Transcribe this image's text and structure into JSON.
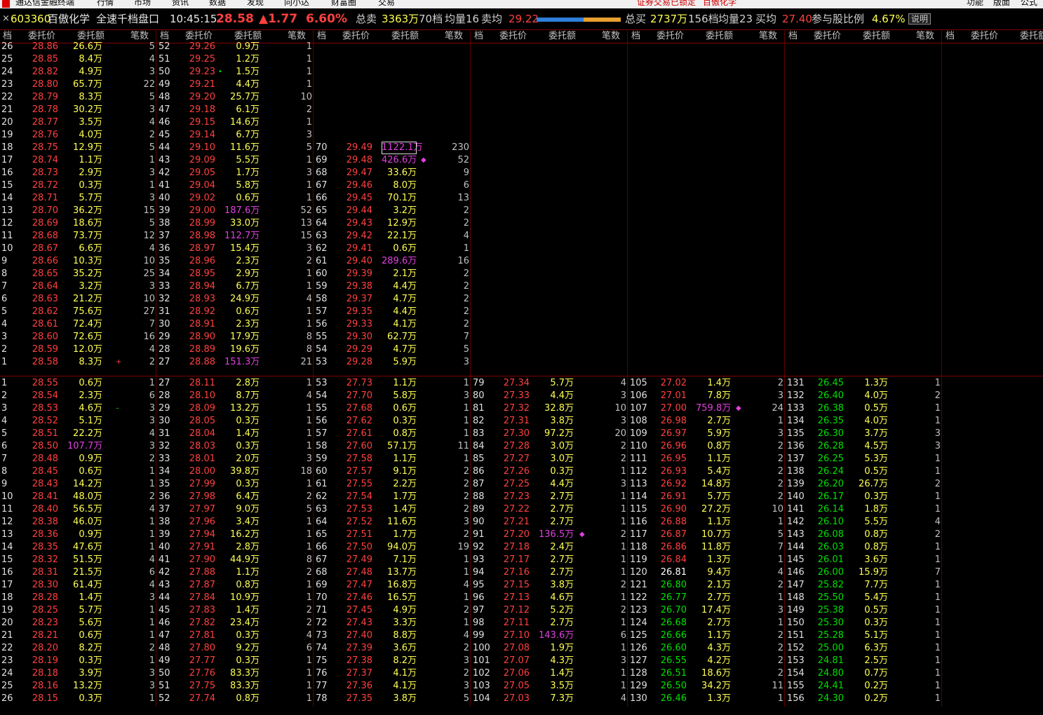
{
  "menubar": {
    "app_title": "通达信金融终端",
    "items": [
      "行情",
      "市场",
      "资讯",
      "数据",
      "发现",
      "向小达",
      "财富圈",
      "交易"
    ],
    "warning": "证券交易已锁定",
    "stock_name": "百傲化学",
    "right_items": [
      "功能",
      "版面",
      "公式"
    ]
  },
  "info": {
    "close": "×",
    "code": "603360",
    "name": "百傲化学",
    "title": "全速千档盘口",
    "time": "10:45:15",
    "price": "28.58",
    "change": "▲1.77",
    "pct": "6.60%",
    "sell_total_label": "总卖",
    "sell_total": "3363万",
    "sell_levels": "70档",
    "sell_avg_label": "均量16",
    "sell_avgp_label": "卖均",
    "sell_avgp": "29.22",
    "buy_total_label": "总买",
    "buy_total": "2737万",
    "buy_levels": "156档",
    "buy_avg_label": "均量23",
    "buy_avgp_label": "买均",
    "buy_avgp": "27.40",
    "part_label": "参与股比例",
    "part_pct": "4.67%",
    "help": "说明",
    "buy_ratio": 0.56
  },
  "header": {
    "lv": "档",
    "price": "委托价",
    "amt": "委托额",
    "cnt": "笔数"
  },
  "colors": {
    "up": "#ff4040",
    "down": "#00e000",
    "amount": "#ffff54",
    "big": "#e040e0",
    "flat": "#ffffff"
  },
  "sell": [
    [
      [
        26,
        "28.86",
        "26.6万",
        5
      ],
      [
        25,
        "28.85",
        "8.4万",
        4
      ],
      [
        24,
        "28.82",
        "4.9万",
        3
      ],
      [
        23,
        "28.80",
        "65.7万",
        22
      ],
      [
        22,
        "28.79",
        "8.3万",
        5
      ],
      [
        21,
        "28.78",
        "30.2万",
        3
      ],
      [
        20,
        "28.77",
        "3.5万",
        4
      ],
      [
        19,
        "28.76",
        "4.0万",
        2
      ],
      [
        18,
        "28.75",
        "12.9万",
        5
      ],
      [
        17,
        "28.74",
        "1.1万",
        1
      ],
      [
        16,
        "28.73",
        "2.9万",
        3
      ],
      [
        15,
        "28.72",
        "0.3万",
        1
      ],
      [
        14,
        "28.71",
        "5.7万",
        3
      ],
      [
        13,
        "28.70",
        "36.2万",
        15
      ],
      [
        12,
        "28.69",
        "18.6万",
        5
      ],
      [
        11,
        "28.68",
        "73.7万",
        12
      ],
      [
        10,
        "28.67",
        "6.6万",
        4
      ],
      [
        9,
        "28.66",
        "10.3万",
        10
      ],
      [
        8,
        "28.65",
        "35.2万",
        25
      ],
      [
        7,
        "28.64",
        "3.2万",
        3
      ],
      [
        6,
        "28.63",
        "21.2万",
        10
      ],
      [
        5,
        "28.62",
        "75.6万",
        27
      ],
      [
        4,
        "28.61",
        "72.4万",
        7
      ],
      [
        3,
        "28.60",
        "72.6万",
        16
      ],
      [
        2,
        "28.59",
        "12.0万",
        4
      ],
      [
        1,
        "28.58",
        "8.3万",
        2
      ]
    ],
    [
      [
        52,
        "29.26",
        "0.9万",
        1
      ],
      [
        51,
        "29.25",
        "1.2万",
        1
      ],
      [
        50,
        "29.23",
        "1.5万",
        1
      ],
      [
        49,
        "29.21",
        "4.4万",
        1
      ],
      [
        48,
        "29.20",
        "25.7万",
        10
      ],
      [
        47,
        "29.18",
        "6.1万",
        2
      ],
      [
        46,
        "29.15",
        "14.6万",
        1
      ],
      [
        45,
        "29.14",
        "6.7万",
        3
      ],
      [
        44,
        "29.10",
        "11.6万",
        5
      ],
      [
        43,
        "29.09",
        "5.5万",
        1
      ],
      [
        42,
        "29.05",
        "1.7万",
        3
      ],
      [
        41,
        "29.04",
        "5.8万",
        1
      ],
      [
        40,
        "29.02",
        "0.6万",
        1
      ],
      [
        39,
        "29.00",
        "187.6万",
        52
      ],
      [
        38,
        "28.99",
        "33.0万",
        13
      ],
      [
        37,
        "28.98",
        "112.7万",
        15
      ],
      [
        36,
        "28.97",
        "15.4万",
        3
      ],
      [
        35,
        "28.96",
        "2.3万",
        2
      ],
      [
        34,
        "28.95",
        "2.9万",
        1
      ],
      [
        33,
        "28.94",
        "6.7万",
        1
      ],
      [
        32,
        "28.93",
        "24.9万",
        4
      ],
      [
        31,
        "28.92",
        "0.6万",
        1
      ],
      [
        30,
        "28.91",
        "2.3万",
        1
      ],
      [
        29,
        "28.90",
        "17.9万",
        8
      ],
      [
        28,
        "28.89",
        "19.6万",
        8
      ],
      [
        27,
        "28.88",
        "151.3万",
        21
      ]
    ],
    [
      [
        null,
        "",
        "",
        ""
      ],
      [
        null,
        "",
        "",
        ""
      ],
      [
        null,
        "",
        "",
        ""
      ],
      [
        null,
        "",
        "",
        ""
      ],
      [
        null,
        "",
        "",
        ""
      ],
      [
        null,
        "",
        "",
        ""
      ],
      [
        null,
        "",
        "",
        ""
      ],
      [
        null,
        "",
        "",
        ""
      ],
      [
        70,
        "29.49",
        "1122.1万",
        230
      ],
      [
        69,
        "29.48",
        "426.6万",
        52
      ],
      [
        68,
        "29.47",
        "33.6万",
        9
      ],
      [
        67,
        "29.46",
        "8.0万",
        6
      ],
      [
        66,
        "29.45",
        "70.1万",
        13
      ],
      [
        65,
        "29.44",
        "3.2万",
        2
      ],
      [
        64,
        "29.43",
        "12.9万",
        2
      ],
      [
        63,
        "29.42",
        "22.1万",
        4
      ],
      [
        62,
        "29.41",
        "0.6万",
        1
      ],
      [
        61,
        "29.40",
        "289.6万",
        16
      ],
      [
        60,
        "29.39",
        "2.1万",
        2
      ],
      [
        59,
        "29.38",
        "4.4万",
        2
      ],
      [
        58,
        "29.37",
        "4.7万",
        2
      ],
      [
        57,
        "29.35",
        "4.4万",
        2
      ],
      [
        56,
        "29.33",
        "4.1万",
        2
      ],
      [
        55,
        "29.30",
        "62.7万",
        7
      ],
      [
        54,
        "29.29",
        "4.7万",
        5
      ],
      [
        53,
        "29.28",
        "5.9万",
        3
      ]
    ]
  ],
  "buy": [
    [
      [
        1,
        "28.55",
        "0.6万",
        1
      ],
      [
        2,
        "28.54",
        "2.3万",
        6
      ],
      [
        3,
        "28.53",
        "4.6万",
        3
      ],
      [
        4,
        "28.52",
        "5.1万",
        3
      ],
      [
        5,
        "28.51",
        "22.2万",
        4
      ],
      [
        6,
        "28.50",
        "107.7万",
        3
      ],
      [
        7,
        "28.48",
        "0.9万",
        2
      ],
      [
        8,
        "28.45",
        "0.6万",
        1
      ],
      [
        9,
        "28.43",
        "14.2万",
        1
      ],
      [
        10,
        "28.41",
        "48.0万",
        2
      ],
      [
        11,
        "28.40",
        "56.5万",
        4
      ],
      [
        12,
        "28.38",
        "46.0万",
        1
      ],
      [
        13,
        "28.36",
        "0.9万",
        1
      ],
      [
        14,
        "28.35",
        "47.6万",
        1
      ],
      [
        15,
        "28.32",
        "51.5万",
        4
      ],
      [
        16,
        "28.31",
        "21.5万",
        6
      ],
      [
        17,
        "28.30",
        "61.4万",
        4
      ],
      [
        18,
        "28.28",
        "1.4万",
        3
      ],
      [
        19,
        "28.25",
        "5.7万",
        1
      ],
      [
        20,
        "28.23",
        "5.6万",
        1
      ],
      [
        21,
        "28.21",
        "0.6万",
        1
      ],
      [
        22,
        "28.20",
        "8.2万",
        2
      ],
      [
        23,
        "28.19",
        "0.3万",
        1
      ],
      [
        24,
        "28.18",
        "3.9万",
        3
      ],
      [
        25,
        "28.16",
        "13.2万",
        3
      ],
      [
        26,
        "28.15",
        "0.3万",
        1
      ]
    ],
    [
      [
        27,
        "28.11",
        "2.8万",
        1
      ],
      [
        28,
        "28.10",
        "8.7万",
        4
      ],
      [
        29,
        "28.09",
        "13.2万",
        1
      ],
      [
        30,
        "28.05",
        "0.3万",
        1
      ],
      [
        31,
        "28.04",
        "1.4万",
        1
      ],
      [
        32,
        "28.03",
        "0.3万",
        1
      ],
      [
        33,
        "28.01",
        "2.0万",
        3
      ],
      [
        34,
        "28.00",
        "39.8万",
        18
      ],
      [
        35,
        "27.99",
        "0.3万",
        1
      ],
      [
        36,
        "27.98",
        "6.4万",
        2
      ],
      [
        37,
        "27.97",
        "9.0万",
        5
      ],
      [
        38,
        "27.96",
        "3.4万",
        1
      ],
      [
        39,
        "27.94",
        "16.2万",
        1
      ],
      [
        40,
        "27.91",
        "2.8万",
        1
      ],
      [
        41,
        "27.90",
        "44.9万",
        8
      ],
      [
        42,
        "27.88",
        "1.1万",
        2
      ],
      [
        43,
        "27.87",
        "0.8万",
        1
      ],
      [
        44,
        "27.84",
        "10.9万",
        1
      ],
      [
        45,
        "27.83",
        "1.4万",
        2
      ],
      [
        46,
        "27.82",
        "23.4万",
        2
      ],
      [
        47,
        "27.81",
        "0.3万",
        4
      ],
      [
        48,
        "27.80",
        "9.2万",
        6
      ],
      [
        49,
        "27.77",
        "0.3万",
        1
      ],
      [
        50,
        "27.76",
        "83.3万",
        1
      ],
      [
        51,
        "27.75",
        "83.3万",
        1
      ],
      [
        52,
        "27.74",
        "0.8万",
        1
      ]
    ],
    [
      [
        53,
        "27.73",
        "1.1万",
        1
      ],
      [
        54,
        "27.70",
        "5.8万",
        3
      ],
      [
        55,
        "27.68",
        "0.6万",
        1
      ],
      [
        56,
        "27.62",
        "0.3万",
        1
      ],
      [
        57,
        "27.61",
        "0.8万",
        1
      ],
      [
        58,
        "27.60",
        "57.1万",
        11
      ],
      [
        59,
        "27.58",
        "1.1万",
        1
      ],
      [
        60,
        "27.57",
        "9.1万",
        2
      ],
      [
        61,
        "27.55",
        "2.2万",
        2
      ],
      [
        62,
        "27.54",
        "1.7万",
        2
      ],
      [
        63,
        "27.53",
        "1.4万",
        2
      ],
      [
        64,
        "27.52",
        "11.6万",
        3
      ],
      [
        65,
        "27.51",
        "1.7万",
        2
      ],
      [
        66,
        "27.50",
        "94.0万",
        19
      ],
      [
        67,
        "27.49",
        "7.1万",
        1
      ],
      [
        68,
        "27.48",
        "13.7万",
        1
      ],
      [
        69,
        "27.47",
        "16.8万",
        4
      ],
      [
        70,
        "27.46",
        "16.5万",
        1
      ],
      [
        71,
        "27.45",
        "4.9万",
        2
      ],
      [
        72,
        "27.43",
        "3.3万",
        1
      ],
      [
        73,
        "27.40",
        "8.8万",
        4
      ],
      [
        74,
        "27.39",
        "3.6万",
        2
      ],
      [
        75,
        "27.38",
        "8.2万",
        3
      ],
      [
        76,
        "27.37",
        "4.1万",
        2
      ],
      [
        77,
        "27.36",
        "4.1万",
        3
      ],
      [
        78,
        "27.35",
        "3.8万",
        5
      ]
    ],
    [
      [
        79,
        "27.34",
        "5.7万",
        4
      ],
      [
        80,
        "27.33",
        "4.4万",
        3
      ],
      [
        81,
        "27.32",
        "32.8万",
        10
      ],
      [
        82,
        "27.31",
        "3.8万",
        3
      ],
      [
        83,
        "27.30",
        "97.2万",
        20
      ],
      [
        84,
        "27.28",
        "3.0万",
        2
      ],
      [
        85,
        "27.27",
        "3.0万",
        2
      ],
      [
        86,
        "27.26",
        "0.3万",
        1
      ],
      [
        87,
        "27.25",
        "4.4万",
        3
      ],
      [
        88,
        "27.23",
        "2.7万",
        1
      ],
      [
        89,
        "27.22",
        "2.7万",
        1
      ],
      [
        90,
        "27.21",
        "2.7万",
        1
      ],
      [
        91,
        "27.20",
        "136.5万",
        2
      ],
      [
        92,
        "27.18",
        "2.4万",
        1
      ],
      [
        93,
        "27.17",
        "2.7万",
        1
      ],
      [
        94,
        "27.16",
        "2.7万",
        1
      ],
      [
        95,
        "27.15",
        "3.8万",
        2
      ],
      [
        96,
        "27.13",
        "4.6万",
        1
      ],
      [
        97,
        "27.12",
        "5.2万",
        2
      ],
      [
        98,
        "27.11",
        "2.7万",
        1
      ],
      [
        99,
        "27.10",
        "143.6万",
        6
      ],
      [
        100,
        "27.08",
        "1.9万",
        1
      ],
      [
        101,
        "27.07",
        "4.3万",
        3
      ],
      [
        102,
        "27.06",
        "1.4万",
        1
      ],
      [
        103,
        "27.05",
        "3.5万",
        1
      ],
      [
        104,
        "27.03",
        "7.3万",
        4
      ]
    ],
    [
      [
        105,
        "27.02",
        "1.4万",
        2
      ],
      [
        106,
        "27.01",
        "7.8万",
        3
      ],
      [
        107,
        "27.00",
        "759.8万",
        24
      ],
      [
        108,
        "26.98",
        "2.7万",
        1
      ],
      [
        109,
        "26.97",
        "5.9万",
        3
      ],
      [
        110,
        "26.96",
        "0.8万",
        2
      ],
      [
        111,
        "26.95",
        "1.1万",
        2
      ],
      [
        112,
        "26.93",
        "5.4万",
        2
      ],
      [
        113,
        "26.92",
        "14.8万",
        2
      ],
      [
        114,
        "26.91",
        "5.7万",
        2
      ],
      [
        115,
        "26.90",
        "27.2万",
        10
      ],
      [
        116,
        "26.88",
        "1.1万",
        1
      ],
      [
        117,
        "26.87",
        "10.7万",
        5
      ],
      [
        118,
        "26.86",
        "11.8万",
        7
      ],
      [
        119,
        "26.84",
        "1.3万",
        1
      ],
      [
        120,
        "26.81",
        "9.4万",
        4
      ],
      [
        121,
        "26.80",
        "2.1万",
        2
      ],
      [
        122,
        "26.77",
        "2.7万",
        1
      ],
      [
        123,
        "26.70",
        "17.4万",
        3
      ],
      [
        124,
        "26.68",
        "2.7万",
        1
      ],
      [
        125,
        "26.66",
        "1.1万",
        2
      ],
      [
        126,
        "26.60",
        "4.3万",
        2
      ],
      [
        127,
        "26.55",
        "4.2万",
        2
      ],
      [
        128,
        "26.51",
        "18.6万",
        2
      ],
      [
        129,
        "26.50",
        "34.2万",
        11
      ],
      [
        130,
        "26.46",
        "1.3万",
        1
      ]
    ],
    [
      [
        131,
        "26.45",
        "1.3万",
        1
      ],
      [
        132,
        "26.40",
        "4.0万",
        2
      ],
      [
        133,
        "26.38",
        "0.5万",
        1
      ],
      [
        134,
        "26.35",
        "4.0万",
        1
      ],
      [
        135,
        "26.30",
        "3.7万",
        3
      ],
      [
        136,
        "26.28",
        "4.5万",
        3
      ],
      [
        137,
        "26.25",
        "5.3万",
        1
      ],
      [
        138,
        "26.24",
        "0.5万",
        1
      ],
      [
        139,
        "26.20",
        "26.7万",
        2
      ],
      [
        140,
        "26.17",
        "0.3万",
        1
      ],
      [
        141,
        "26.14",
        "1.8万",
        1
      ],
      [
        142,
        "26.10",
        "5.5万",
        4
      ],
      [
        143,
        "26.08",
        "0.8万",
        2
      ],
      [
        144,
        "26.03",
        "0.8万",
        1
      ],
      [
        145,
        "26.01",
        "3.6万",
        1
      ],
      [
        146,
        "26.00",
        "15.9万",
        7
      ],
      [
        147,
        "25.82",
        "7.7万",
        1
      ],
      [
        148,
        "25.50",
        "5.4万",
        1
      ],
      [
        149,
        "25.38",
        "0.5万",
        1
      ],
      [
        150,
        "25.30",
        "0.3万",
        1
      ],
      [
        151,
        "25.28",
        "5.1万",
        1
      ],
      [
        152,
        "25.00",
        "6.3万",
        1
      ],
      [
        153,
        "24.81",
        "2.5万",
        1
      ],
      [
        154,
        "24.80",
        "0.7万",
        1
      ],
      [
        155,
        "24.41",
        "0.2万",
        1
      ],
      [
        156,
        "24.30",
        "0.2万",
        1
      ]
    ]
  ]
}
